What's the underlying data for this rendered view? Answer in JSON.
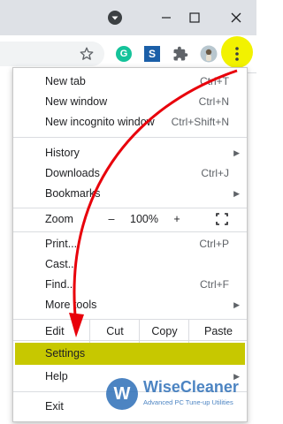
{
  "menu": {
    "new_tab": {
      "label": "New tab",
      "shortcut": "Ctrl+T"
    },
    "new_window": {
      "label": "New window",
      "shortcut": "Ctrl+N"
    },
    "new_incognito": {
      "label": "New incognito window",
      "shortcut": "Ctrl+Shift+N"
    },
    "history": {
      "label": "History"
    },
    "downloads": {
      "label": "Downloads",
      "shortcut": "Ctrl+J"
    },
    "bookmarks": {
      "label": "Bookmarks"
    },
    "zoom": {
      "label": "Zoom",
      "minus": "–",
      "value": "100%",
      "plus": "+"
    },
    "print": {
      "label": "Print...",
      "shortcut": "Ctrl+P"
    },
    "cast": {
      "label": "Cast..."
    },
    "find": {
      "label": "Find...",
      "shortcut": "Ctrl+F"
    },
    "more_tools": {
      "label": "More tools"
    },
    "edit": {
      "label": "Edit",
      "cut": "Cut",
      "copy": "Copy",
      "paste": "Paste"
    },
    "settings": {
      "label": "Settings"
    },
    "help": {
      "label": "Help"
    },
    "exit": {
      "label": "Exit"
    }
  },
  "toolbar": {
    "extension_g_letter": "G",
    "extension_s_letter": "S"
  },
  "watermark": {
    "name": "WiseCleaner",
    "tagline": "Advanced PC Tune-up Utilities",
    "logo_letter": "W"
  },
  "colors": {
    "highlight": "#c7c800",
    "kebab_highlight": "#f2f200",
    "arrow": "#e8000b",
    "watermark_blue": "#2d6fb8"
  },
  "icons": [
    "profile-dropdown-icon",
    "minimize-icon",
    "maximize-icon",
    "close-icon",
    "bookmark-star-icon",
    "grammarly-extension-icon",
    "s-extension-icon",
    "puzzle-extensions-icon",
    "profile-avatar-icon",
    "kebab-menu-icon",
    "fullscreen-icon",
    "submenu-arrow-icon",
    "wisecleaner-logo"
  ]
}
